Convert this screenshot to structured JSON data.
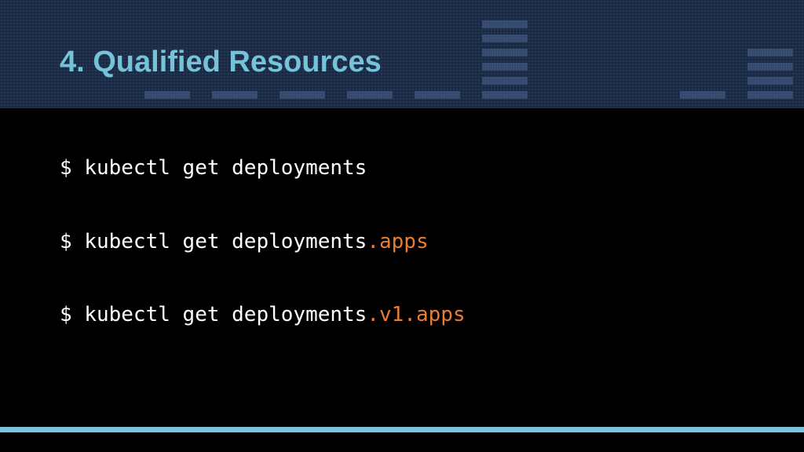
{
  "slide": {
    "title": "4. Qualified Resources",
    "commands": [
      {
        "prompt": "$",
        "base": "kubectl get deployments",
        "suffix": ""
      },
      {
        "prompt": "$",
        "base": "kubectl get deployments",
        "suffix": ".apps"
      },
      {
        "prompt": "$",
        "base": "kubectl get deployments",
        "suffix": ".v1.apps"
      }
    ]
  },
  "colors": {
    "header_background": "#1d2e4b",
    "title": "#74c3d8",
    "code_text": "#ffffff",
    "suffix_highlight": "#e87c30",
    "bottom_rule": "#7ec3d8",
    "body_background": "#000000"
  }
}
